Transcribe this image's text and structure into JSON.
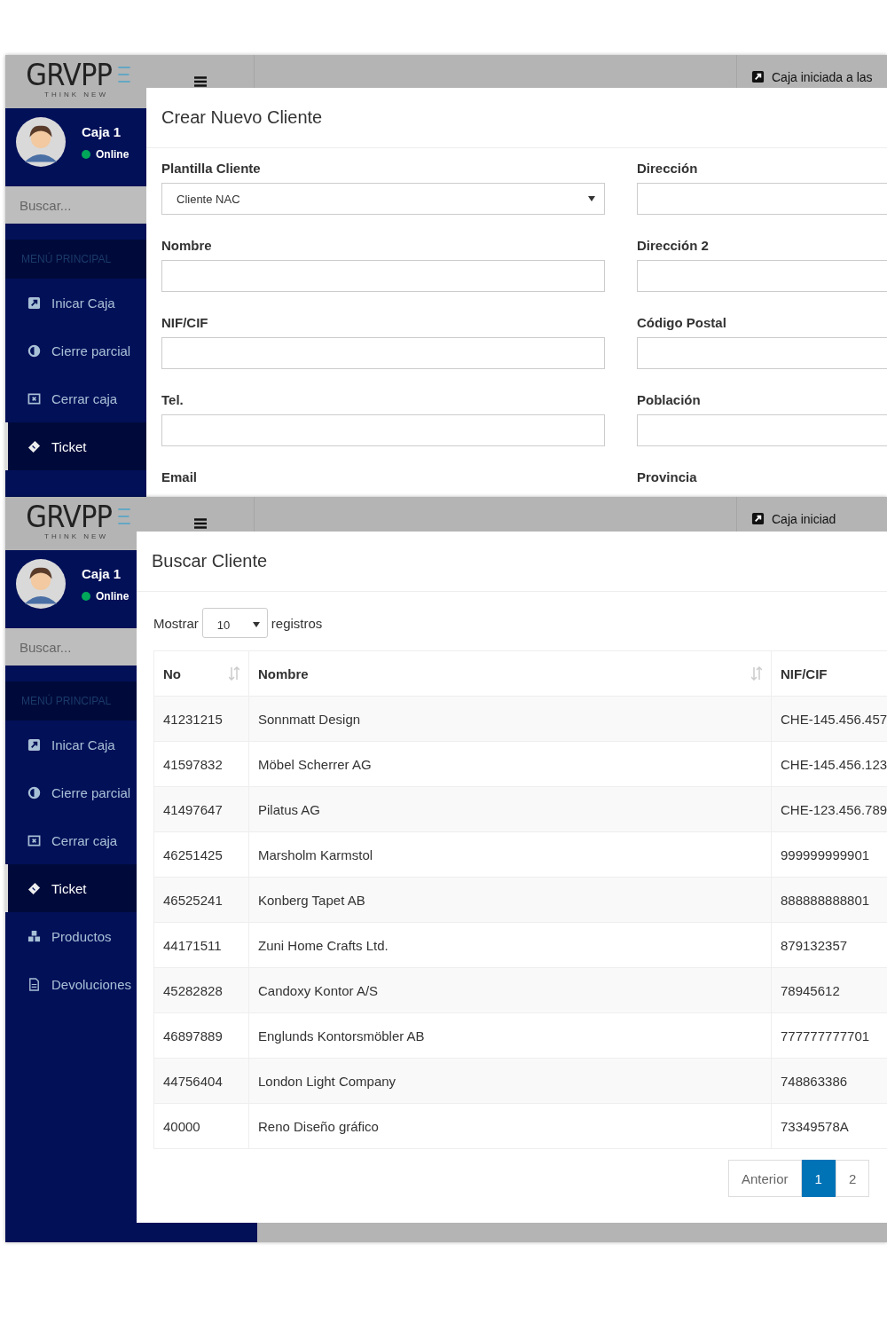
{
  "screens": [
    {
      "kind": "form",
      "logo": {
        "name": "GRVPP",
        "tagline": "THINK NEW"
      },
      "header": {
        "status": "Caja iniciada a las"
      },
      "user": {
        "name": "Caja 1",
        "status": "Online"
      },
      "search": {
        "placeholder": "Buscar..."
      },
      "menu": {
        "heading": "MENÚ PRINCIPAL",
        "items": [
          {
            "label": "Inicar Caja",
            "kind": "start",
            "selected": false
          },
          {
            "label": "Cierre parcial",
            "kind": "half",
            "selected": false
          },
          {
            "label": "Cerrar caja",
            "kind": "close",
            "selected": false
          },
          {
            "label": "Ticket",
            "kind": "ticket",
            "selected": true
          }
        ]
      },
      "modal": {
        "title": "Crear Nuevo Cliente",
        "columns": [
          [
            {
              "label": "Plantilla Cliente",
              "kind": "select",
              "value": "Cliente NAC"
            },
            {
              "label": "Nombre",
              "kind": "text"
            },
            {
              "label": "NIF/CIF",
              "kind": "text"
            },
            {
              "label": "Tel.",
              "kind": "text"
            },
            {
              "label": "Email",
              "kind": "label"
            }
          ],
          [
            {
              "label": "Dirección",
              "kind": "text"
            },
            {
              "label": "Dirección 2",
              "kind": "text"
            },
            {
              "label": "Código Postal",
              "kind": "text"
            },
            {
              "label": "Población",
              "kind": "text"
            },
            {
              "label": "Provincia",
              "kind": "label"
            }
          ]
        ]
      }
    },
    {
      "kind": "table",
      "logo": {
        "name": "GRVPP",
        "tagline": "THINK NEW"
      },
      "header": {
        "status": "Caja iniciad"
      },
      "user": {
        "name": "Caja 1",
        "status": "Online"
      },
      "search": {
        "placeholder": "Buscar..."
      },
      "menu": {
        "heading": "MENÚ PRINCIPAL",
        "items": [
          {
            "label": "Inicar Caja",
            "kind": "start",
            "selected": false
          },
          {
            "label": "Cierre parcial",
            "kind": "half",
            "selected": false
          },
          {
            "label": "Cerrar caja",
            "kind": "close",
            "selected": false
          },
          {
            "label": "Ticket",
            "kind": "ticket",
            "selected": true
          },
          {
            "label": "Productos",
            "kind": "cubes",
            "selected": false
          },
          {
            "label": "Devoluciones",
            "kind": "doc",
            "selected": false
          }
        ]
      },
      "modal": {
        "title": "Buscar Cliente",
        "length": {
          "before": "Mostrar",
          "value": "10",
          "after": "registros"
        },
        "columns": [
          {
            "label": "No",
            "sortable": true
          },
          {
            "label": "Nombre",
            "sortable": true
          },
          {
            "label": "NIF/CIF"
          }
        ],
        "rows": [
          [
            "41231215",
            "Sonnmatt Design",
            "CHE-145.456.457"
          ],
          [
            "41597832",
            "Möbel Scherrer AG",
            "CHE-145.456.123"
          ],
          [
            "41497647",
            "Pilatus AG",
            "CHE-123.456.789"
          ],
          [
            "46251425",
            "Marsholm Karmstol",
            "999999999901"
          ],
          [
            "46525241",
            "Konberg Tapet AB",
            "888888888801"
          ],
          [
            "44171511",
            "Zuni Home Crafts Ltd.",
            "879132357"
          ],
          [
            "45282828",
            "Candoxy Kontor A/S",
            "78945612"
          ],
          [
            "46897889",
            "Englunds Kontorsmöbler AB",
            "777777777701"
          ],
          [
            "44756404",
            "London Light Company",
            "748863386"
          ],
          [
            "40000",
            "Reno Diseño gráfico",
            "73349578A"
          ]
        ],
        "pages": [
          {
            "label": "Anterior",
            "selected": false
          },
          {
            "label": "1",
            "selected": true
          },
          {
            "label": "2",
            "selected": false
          }
        ]
      }
    }
  ]
}
